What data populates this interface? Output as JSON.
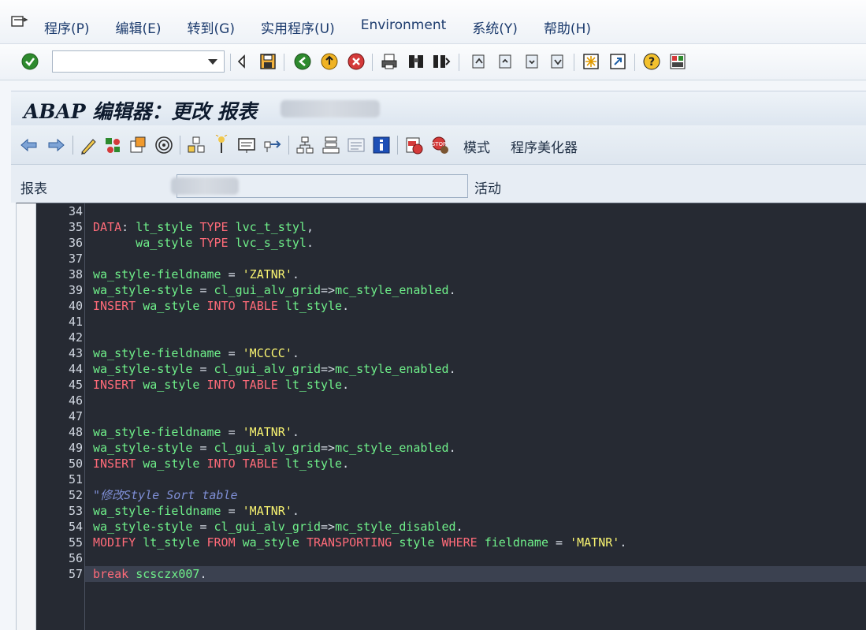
{
  "menubar": {
    "items": [
      "程序(P)",
      "编辑(E)",
      "转到(G)",
      "实用程序(U)",
      "Environment",
      "系统(Y)",
      "帮助(H)"
    ]
  },
  "toolbar": {
    "command_value": ""
  },
  "title": {
    "text": "ABAP 编辑器：更改 报表"
  },
  "app_toolbar": {
    "mode_label": "模式",
    "pretty_printer_label": "程序美化器"
  },
  "report": {
    "label": "报表",
    "status": "活动"
  },
  "editor": {
    "line_numbers": [
      "34",
      "35",
      "36",
      "37",
      "38",
      "39",
      "40",
      "41",
      "42",
      "43",
      "44",
      "45",
      "46",
      "47",
      "48",
      "49",
      "50",
      "51",
      "52",
      "53",
      "54",
      "55",
      "56",
      "57"
    ],
    "current_line": "57",
    "lines": [
      [],
      [
        [
          "k",
          "DATA"
        ],
        [
          "o",
          ": "
        ],
        [
          "i",
          "lt_style "
        ],
        [
          "k",
          "TYPE "
        ],
        [
          "i",
          "lvc_t_styl"
        ],
        [
          "o",
          ","
        ]
      ],
      [
        [
          "i",
          "      wa_style "
        ],
        [
          "k",
          "TYPE "
        ],
        [
          "i",
          "lvc_s_styl"
        ],
        [
          "o",
          "."
        ]
      ],
      [],
      [
        [
          "i",
          "wa_style-fieldname "
        ],
        [
          "o",
          "= "
        ],
        [
          "s",
          "'ZATNR'"
        ],
        [
          "o",
          "."
        ]
      ],
      [
        [
          "i",
          "wa_style-style "
        ],
        [
          "o",
          "= "
        ],
        [
          "i",
          "cl_gui_alv_grid"
        ],
        [
          "o",
          "=>"
        ],
        [
          "i",
          "mc_style_enabled"
        ],
        [
          "o",
          "."
        ]
      ],
      [
        [
          "k",
          "INSERT "
        ],
        [
          "i",
          "wa_style "
        ],
        [
          "k",
          "INTO TABLE "
        ],
        [
          "i",
          "lt_style"
        ],
        [
          "o",
          "."
        ]
      ],
      [],
      [],
      [
        [
          "i",
          "wa_style-fieldname "
        ],
        [
          "o",
          "= "
        ],
        [
          "s",
          "'MCCCC'"
        ],
        [
          "o",
          "."
        ]
      ],
      [
        [
          "i",
          "wa_style-style "
        ],
        [
          "o",
          "= "
        ],
        [
          "i",
          "cl_gui_alv_grid"
        ],
        [
          "o",
          "=>"
        ],
        [
          "i",
          "mc_style_enabled"
        ],
        [
          "o",
          "."
        ]
      ],
      [
        [
          "k",
          "INSERT "
        ],
        [
          "i",
          "wa_style "
        ],
        [
          "k",
          "INTO TABLE "
        ],
        [
          "i",
          "lt_style"
        ],
        [
          "o",
          "."
        ]
      ],
      [],
      [],
      [
        [
          "i",
          "wa_style-fieldname "
        ],
        [
          "o",
          "= "
        ],
        [
          "s",
          "'MATNR'"
        ],
        [
          "o",
          "."
        ]
      ],
      [
        [
          "i",
          "wa_style-style "
        ],
        [
          "o",
          "= "
        ],
        [
          "i",
          "cl_gui_alv_grid"
        ],
        [
          "o",
          "=>"
        ],
        [
          "i",
          "mc_style_enabled"
        ],
        [
          "o",
          "."
        ]
      ],
      [
        [
          "k",
          "INSERT "
        ],
        [
          "i",
          "wa_style "
        ],
        [
          "k",
          "INTO TABLE "
        ],
        [
          "i",
          "lt_style"
        ],
        [
          "o",
          "."
        ]
      ],
      [],
      [
        [
          "cm",
          "\"修改Style Sort table"
        ]
      ],
      [
        [
          "i",
          "wa_style-fieldname "
        ],
        [
          "o",
          "= "
        ],
        [
          "s",
          "'MATNR'"
        ],
        [
          "o",
          "."
        ]
      ],
      [
        [
          "i",
          "wa_style-style "
        ],
        [
          "o",
          "= "
        ],
        [
          "i",
          "cl_gui_alv_grid"
        ],
        [
          "o",
          "=>"
        ],
        [
          "i",
          "mc_style_disabled"
        ],
        [
          "o",
          "."
        ]
      ],
      [
        [
          "k",
          "MODIFY "
        ],
        [
          "i",
          "lt_style "
        ],
        [
          "k",
          "FROM "
        ],
        [
          "i",
          "wa_style "
        ],
        [
          "k",
          "TRANSPORTING "
        ],
        [
          "i",
          "style "
        ],
        [
          "k",
          "WHERE "
        ],
        [
          "i",
          "fieldname "
        ],
        [
          "o",
          "= "
        ],
        [
          "s",
          "'MATNR'"
        ],
        [
          "o",
          "."
        ]
      ],
      [],
      [
        [
          "k",
          "break "
        ],
        [
          "i",
          "scsczx007"
        ],
        [
          "o",
          "."
        ]
      ]
    ]
  }
}
